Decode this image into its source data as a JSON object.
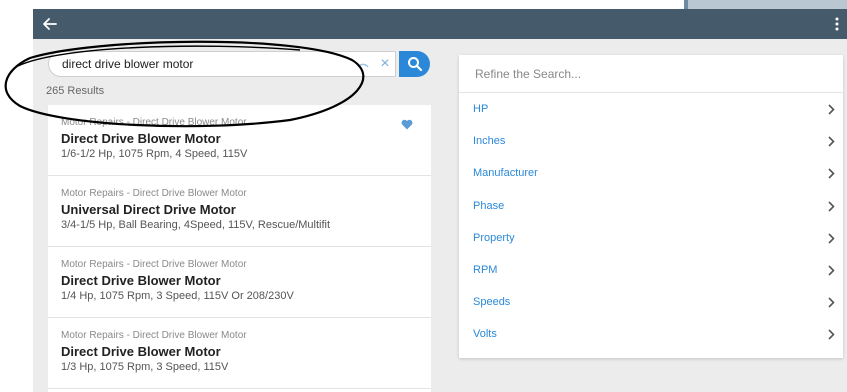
{
  "appbar": {
    "back_icon": "arrow-left-icon",
    "menu_icon": "more-vertical-icon"
  },
  "search": {
    "value": "direct drive blower motor",
    "clear_icon": "close-icon",
    "clear_label": "×",
    "submit_icon": "search-icon",
    "results_count": "265 Results"
  },
  "results": [
    {
      "category": "Motor Repairs - Direct Drive Blower Motor",
      "title": "Direct Drive Blower Motor",
      "description": "1/6-1/2 Hp, 1075 Rpm, 4 Speed, 115V",
      "favorited": true
    },
    {
      "category": "Motor Repairs - Direct Drive Blower Motor",
      "title": "Universal Direct Drive Motor",
      "description": "3/4-1/5 Hp, Ball Bearing, 4Speed, 115V, Rescue/Multifit",
      "favorited": false
    },
    {
      "category": "Motor Repairs - Direct Drive Blower Motor",
      "title": "Direct Drive Blower Motor",
      "description": "1/4 Hp, 1075 Rpm, 3 Speed, 115V Or 208/230V",
      "favorited": false
    },
    {
      "category": "Motor Repairs - Direct Drive Blower Motor",
      "title": "Direct Drive Blower Motor",
      "description": "1/3 Hp, 1075 Rpm, 3 Speed, 115V",
      "favorited": false
    }
  ],
  "refine": {
    "placeholder": "Refine the Search...",
    "filters": [
      "HP",
      "Inches",
      "Manufacturer",
      "Phase",
      "Property",
      "RPM",
      "Speeds",
      "Volts"
    ]
  },
  "colors": {
    "appbar": "#455a6b",
    "accent": "#2b88d8",
    "background": "#ececec"
  }
}
